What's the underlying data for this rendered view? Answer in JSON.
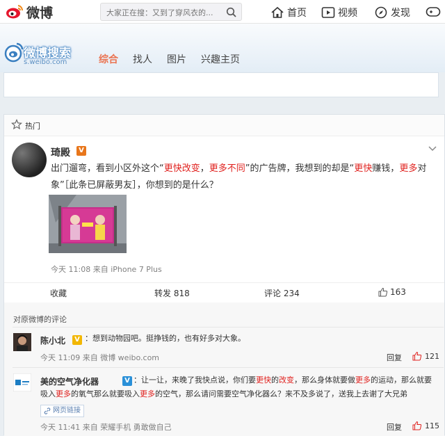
{
  "topbar": {
    "logo_text": "微博",
    "search_placeholder": "大家正在搜：又到了穿风衣的...",
    "nav": [
      {
        "icon": "home-icon",
        "label": "首页"
      },
      {
        "icon": "video-icon",
        "label": "视频"
      },
      {
        "icon": "compass-icon",
        "label": "发现"
      },
      {
        "icon": "game-icon",
        "label": ""
      }
    ]
  },
  "search_header": {
    "title": "微博搜索",
    "subtitle": "s.weibo.com",
    "tabs": [
      "综合",
      "找人",
      "图片",
      "兴趣主页"
    ],
    "active_tab": 0
  },
  "card": {
    "section_label": "热门",
    "post": {
      "author": "琦殿",
      "verified_badge": "V",
      "text_parts": [
        {
          "t": "出门遛弯，看到小区外这个“",
          "hl": false
        },
        {
          "t": "更快改变",
          "hl": true
        },
        {
          "t": "，",
          "hl": false
        },
        {
          "t": "更多不同",
          "hl": true
        },
        {
          "t": "”的广告牌，我想到的却是“",
          "hl": false
        },
        {
          "t": "更快",
          "hl": true
        },
        {
          "t": "赚钱，",
          "hl": false
        },
        {
          "t": "更多",
          "hl": true
        },
        {
          "t": "对象”［此条已屏蔽男友］，你想到的是什么？",
          "hl": false
        }
      ],
      "time_source": "今天 11:08 来自 iPhone 7 Plus"
    },
    "actions": {
      "favorite": "收藏",
      "repost": "转发 818",
      "comment": "评论 234",
      "likes": "163"
    },
    "comments_title": "对原微博的评论",
    "comments": [
      {
        "name": "陈小北",
        "badge": "V",
        "parts": [
          {
            "t": "：想到动物园吧。挺挣钱的，也有好多对大象。",
            "hl": false
          }
        ],
        "meta": "今天 11:09 来自 微博 weibo.com",
        "reply": "回复",
        "likes": "121"
      },
      {
        "name": "美的空气净化器",
        "badge": "V",
        "parts": [
          {
            "t": "：让一让，来晚了我快点说，你们要",
            "hl": false
          },
          {
            "t": "更快",
            "hl": true
          },
          {
            "t": "的",
            "hl": false
          },
          {
            "t": "改变",
            "hl": true
          },
          {
            "t": "，那么身体就要做",
            "hl": false
          },
          {
            "t": "更多",
            "hl": true
          },
          {
            "t": "的运动，那么就要吸入",
            "hl": false
          },
          {
            "t": "更多",
            "hl": true
          },
          {
            "t": "的氧气那么就要吸入",
            "hl": false
          },
          {
            "t": "更多",
            "hl": true
          },
          {
            "t": "的空气，那么请问需要空气净化器么？来不及多说了，送我上去谢了大兄弟",
            "hl": false
          }
        ],
        "link": "网页链接",
        "meta": "今天 11:41 来自 荣耀手机 勇敢做自己",
        "reply": "回复",
        "likes": "115"
      }
    ]
  }
}
